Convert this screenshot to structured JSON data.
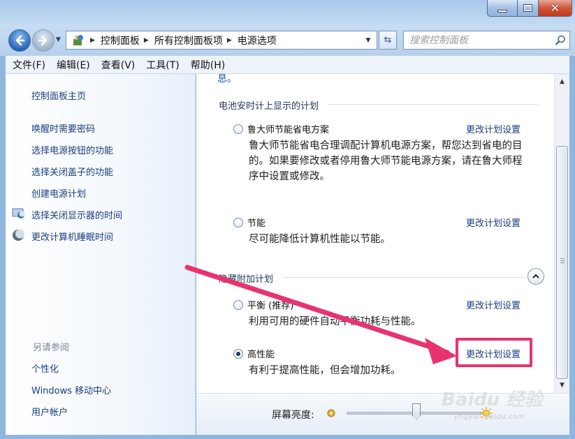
{
  "address_bar": {
    "crumbs": [
      "控制面板",
      "所有控制面板项",
      "电源选项"
    ]
  },
  "search": {
    "placeholder": "搜索控制面板"
  },
  "menu": [
    "文件(F)",
    "编辑(E)",
    "查看(V)",
    "工具(T)",
    "帮助(H)"
  ],
  "sidebar": {
    "home": "控制面板主页",
    "links": [
      "唤醒时需要密码",
      "选择电源按钮的功能",
      "选择关闭盖子的功能",
      "创建电源计划",
      "选择关闭显示器的时间",
      "更改计算机睡眠时间"
    ],
    "see_also_heading": "另请参阅",
    "see_also": [
      "个性化",
      "Windows 移动中心",
      "用户帐户"
    ]
  },
  "main": {
    "top_fragment": "息。",
    "battery_group_label": "电池安时计上显示的计划",
    "hidden_group_label": "隐藏附加计划",
    "change_link": "更改计划设置",
    "plans": [
      {
        "name": "鲁大师节能省电方案",
        "desc": "鲁大师节能省电合理调配计算机电源方案，帮您达到省电的目的。如果要修改或者停用鲁大师节能电源方案，请在鲁大师程序中设置或修改。",
        "selected": false
      },
      {
        "name": "节能",
        "desc": "尽可能降低计算机性能以节能。",
        "selected": false
      },
      {
        "name": "平衡 (推荐)",
        "desc": "利用可用的硬件自动平衡功耗与性能。",
        "selected": false
      },
      {
        "name": "高性能",
        "desc": "有利于提高性能，但会增加功耗。",
        "selected": true
      }
    ]
  },
  "brightness": {
    "label": "屏幕亮度:",
    "level": 0.5
  },
  "watermark": {
    "brand": "Baidu 经验",
    "url": "jingyan.baidu.com"
  },
  "colors": {
    "accent_link": "#1b3c80",
    "annotation": "#e8336f"
  }
}
